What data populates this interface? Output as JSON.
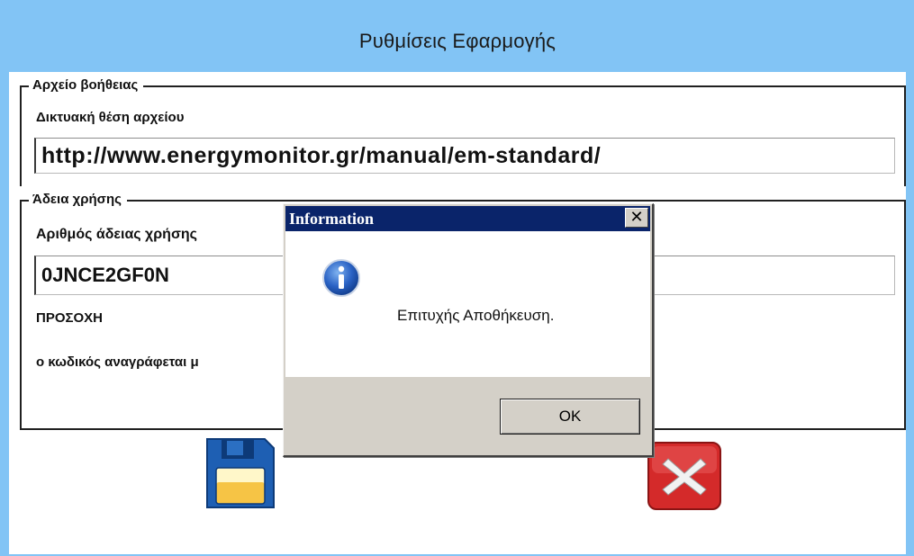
{
  "window": {
    "title": "Ρυθμίσεις Εφαρμογής"
  },
  "help_group": {
    "legend": "Αρχείο βοήθειας",
    "field_label": "Δικτυακή θέση αρχείου",
    "field_value": "http://www.energymonitor.gr/manual/em-standard/"
  },
  "license_group": {
    "legend": "Άδεια χρήσης",
    "field_label": "Αριθμός άδειας χρήσης",
    "field_value": "0JNCE2GF0N",
    "warning_title": "ΠΡΟΣΟΧΗ",
    "warning_text": "ο κωδικός αναγράφεται μ"
  },
  "buttons": {
    "save_icon": "floppy-disk-icon",
    "cancel_icon": "red-x-icon"
  },
  "dialog": {
    "title": "Information",
    "close_glyph": "✕",
    "icon": "info-icon",
    "message": "Επιτυχής Αποθήκευση.",
    "ok_label": "OK"
  },
  "colors": {
    "window_frame": "#82c4f5",
    "dialog_title_bar": "#0a246a",
    "dialog_face": "#d4d0c8",
    "cancel_red": "#d42a2a",
    "save_blue": "#1e5fb3"
  }
}
